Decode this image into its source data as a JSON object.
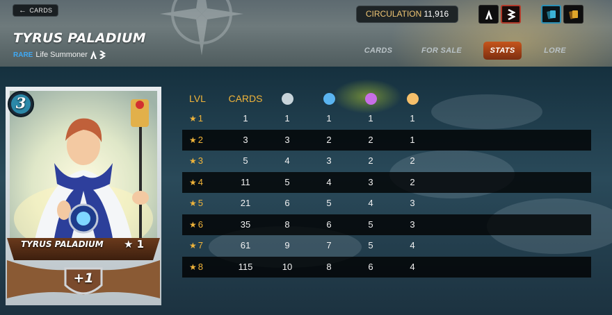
{
  "header": {
    "back_label": "CARDS",
    "title": "TYRUS PALADIUM",
    "rarity": "RARE",
    "type_text": "Life Summoner",
    "circulation_label": "CIRCULATION",
    "circulation_value": "11,916"
  },
  "tabs": [
    {
      "label": "CARDS",
      "active": false
    },
    {
      "label": "FOR SALE",
      "active": false
    },
    {
      "label": "STATS",
      "active": true
    },
    {
      "label": "LORE",
      "active": false
    }
  ],
  "card": {
    "mana": "3",
    "name": "TYRUS PALADIUM",
    "level_label": "★ 1",
    "bonus": "+1"
  },
  "colors": {
    "accent_orange": "#f0b43a",
    "tab_active": "#c6551c",
    "rarity_blue": "#3fa9f5",
    "dot_white": "#c8d4da",
    "dot_blue": "#5ab4f0",
    "dot_purple": "#c86ee6",
    "dot_gold": "#f5bf6a"
  },
  "icons": {
    "back": "arrow-left-icon",
    "edition_alpha": "alpha-edition-icon",
    "edition_beta": "beta-edition-icon",
    "foil_regular": "regular-card-icon",
    "foil_gold": "gold-card-icon"
  },
  "stats": {
    "headers": [
      "LVL",
      "CARDS"
    ],
    "dot_columns": [
      "regular",
      "gold",
      "purple",
      "legendary"
    ],
    "rows": [
      {
        "lvl": "1",
        "cards": "1",
        "c1": "1",
        "c2": "1",
        "c3": "1",
        "c4": "1"
      },
      {
        "lvl": "2",
        "cards": "3",
        "c1": "3",
        "c2": "2",
        "c3": "2",
        "c4": "1"
      },
      {
        "lvl": "3",
        "cards": "5",
        "c1": "4",
        "c2": "3",
        "c3": "2",
        "c4": "2"
      },
      {
        "lvl": "4",
        "cards": "11",
        "c1": "5",
        "c2": "4",
        "c3": "3",
        "c4": "2"
      },
      {
        "lvl": "5",
        "cards": "21",
        "c1": "6",
        "c2": "5",
        "c3": "4",
        "c4": "3"
      },
      {
        "lvl": "6",
        "cards": "35",
        "c1": "8",
        "c2": "6",
        "c3": "5",
        "c4": "3"
      },
      {
        "lvl": "7",
        "cards": "61",
        "c1": "9",
        "c2": "7",
        "c3": "5",
        "c4": "4"
      },
      {
        "lvl": "8",
        "cards": "115",
        "c1": "10",
        "c2": "8",
        "c3": "6",
        "c4": "4"
      }
    ]
  }
}
